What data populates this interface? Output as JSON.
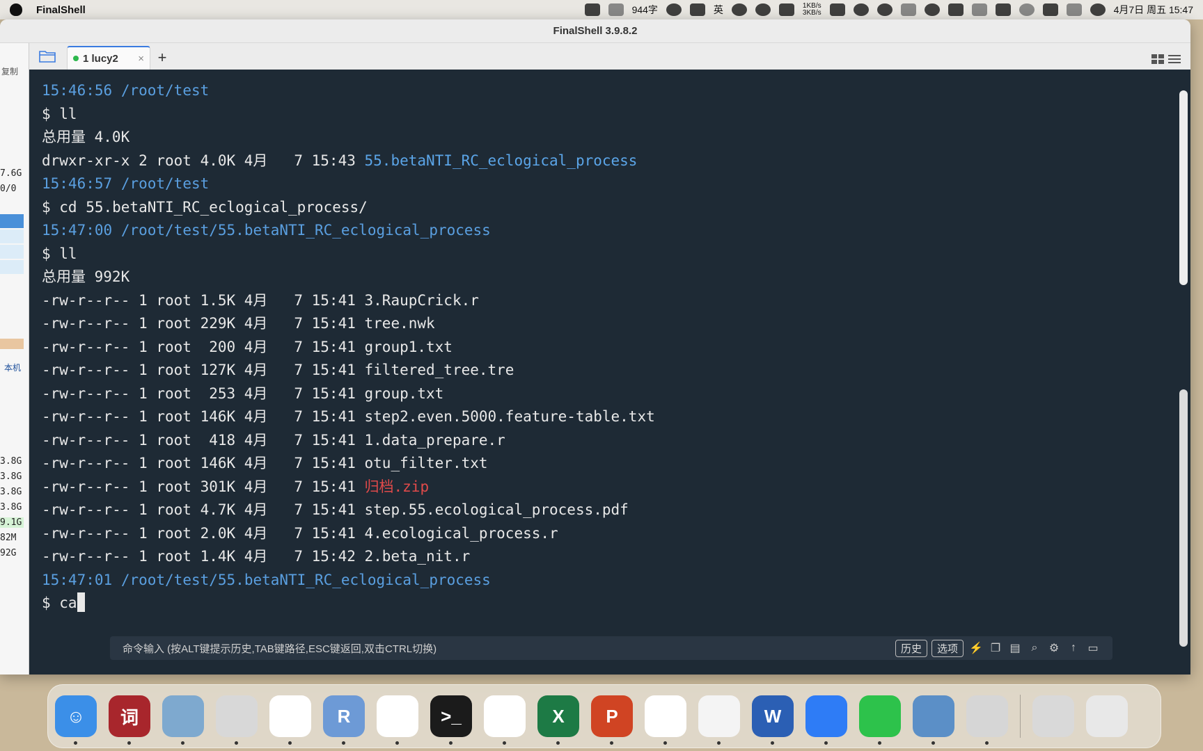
{
  "menubar": {
    "app_name": "FinalShell",
    "input_count": "944字",
    "ime_label": "英",
    "net_up": "1KB/s",
    "net_down": "3KB/s",
    "datetime": "4月7日 周五 15:47"
  },
  "window": {
    "title": "FinalShell 3.9.8.2"
  },
  "leftpanel": {
    "copy_label": "复制",
    "stats_top": [
      "7.6G",
      "0/0"
    ],
    "local_label": "本机",
    "stats_bottom": [
      "3.8G",
      "3.8G",
      "3.8G",
      "3.8G",
      "9.1G",
      "82M",
      "92G"
    ]
  },
  "tabs": [
    {
      "label": "1 lucy2",
      "close": "×"
    }
  ],
  "tab_add": "+",
  "terminal": {
    "lines": [
      {
        "type": "stamp",
        "time": "15:46:56",
        "path": "/root/test"
      },
      {
        "type": "cmd",
        "text": "$ ll"
      },
      {
        "type": "plain",
        "text": "总用量 4.0K"
      },
      {
        "type": "file",
        "meta": "drwxr-xr-x 2 root 4.0K 4月   7 15:43 ",
        "name": "55.betaNTI_RC_eclogical_process",
        "kind": "dir"
      },
      {
        "type": "stamp",
        "time": "15:46:57",
        "path": "/root/test"
      },
      {
        "type": "cmd",
        "text": "$ cd 55.betaNTI_RC_eclogical_process/"
      },
      {
        "type": "stamp",
        "time": "15:47:00",
        "path": "/root/test/55.betaNTI_RC_eclogical_process"
      },
      {
        "type": "cmd",
        "text": "$ ll"
      },
      {
        "type": "plain",
        "text": "总用量 992K"
      },
      {
        "type": "file",
        "meta": "-rw-r--r-- 1 root 1.5K 4月   7 15:41 ",
        "name": "3.RaupCrick.r",
        "kind": "file"
      },
      {
        "type": "file",
        "meta": "-rw-r--r-- 1 root 229K 4月   7 15:41 ",
        "name": "tree.nwk",
        "kind": "file"
      },
      {
        "type": "file",
        "meta": "-rw-r--r-- 1 root  200 4月   7 15:41 ",
        "name": "group1.txt",
        "kind": "file"
      },
      {
        "type": "file",
        "meta": "-rw-r--r-- 1 root 127K 4月   7 15:41 ",
        "name": "filtered_tree.tre",
        "kind": "file"
      },
      {
        "type": "file",
        "meta": "-rw-r--r-- 1 root  253 4月   7 15:41 ",
        "name": "group.txt",
        "kind": "file"
      },
      {
        "type": "file",
        "meta": "-rw-r--r-- 1 root 146K 4月   7 15:41 ",
        "name": "step2.even.5000.feature-table.txt",
        "kind": "file"
      },
      {
        "type": "file",
        "meta": "-rw-r--r-- 1 root  418 4月   7 15:41 ",
        "name": "1.data_prepare.r",
        "kind": "file"
      },
      {
        "type": "file",
        "meta": "-rw-r--r-- 1 root 146K 4月   7 15:41 ",
        "name": "otu_filter.txt",
        "kind": "file"
      },
      {
        "type": "file",
        "meta": "-rw-r--r-- 1 root 301K 4月   7 15:41 ",
        "name": "归档.zip",
        "kind": "zip"
      },
      {
        "type": "file",
        "meta": "-rw-r--r-- 1 root 4.7K 4月   7 15:41 ",
        "name": "step.55.ecological_process.pdf",
        "kind": "file"
      },
      {
        "type": "file",
        "meta": "-rw-r--r-- 1 root 2.0K 4月   7 15:41 ",
        "name": "4.ecological_process.r",
        "kind": "file"
      },
      {
        "type": "file",
        "meta": "-rw-r--r-- 1 root 1.4K 4月   7 15:42 ",
        "name": "2.beta_nit.r",
        "kind": "file"
      },
      {
        "type": "stamp",
        "time": "15:47:01",
        "path": "/root/test/55.betaNTI_RC_eclogical_process"
      },
      {
        "type": "prompt",
        "text": "$ ca"
      }
    ]
  },
  "cmdbar": {
    "placeholder": "命令输入 (按ALT键提示历史,TAB键路径,ESC键返回,双击CTRL切换)",
    "history_label": "历史",
    "options_label": "选项"
  },
  "dock": {
    "apps": [
      {
        "name": "finder",
        "color": "#3b8fe8",
        "glyph": "☺"
      },
      {
        "name": "dictionary",
        "color": "#a8262c",
        "glyph": "词"
      },
      {
        "name": "preview",
        "color": "#7ea9cf",
        "glyph": ""
      },
      {
        "name": "launchpad",
        "color": "#d8d8d8",
        "glyph": ""
      },
      {
        "name": "evernote",
        "color": "#ffffff",
        "glyph": ""
      },
      {
        "name": "r-app",
        "color": "#6d9ad6",
        "glyph": "R"
      },
      {
        "name": "chrome",
        "color": "#ffffff",
        "glyph": ""
      },
      {
        "name": "terminal",
        "color": "#1b1b1b",
        "glyph": ">_"
      },
      {
        "name": "qq",
        "color": "#ffffff",
        "glyph": ""
      },
      {
        "name": "excel",
        "color": "#1d7a45",
        "glyph": "X"
      },
      {
        "name": "powerpoint",
        "color": "#d04423",
        "glyph": "P"
      },
      {
        "name": "baidu-netdisk",
        "color": "#ffffff",
        "glyph": ""
      },
      {
        "name": "textedit",
        "color": "#f4f4f4",
        "glyph": ""
      },
      {
        "name": "word",
        "color": "#2b5fb4",
        "glyph": "W"
      },
      {
        "name": "tencent-app",
        "color": "#2e7cf6",
        "glyph": ""
      },
      {
        "name": "wechat",
        "color": "#2dc24b",
        "glyph": ""
      },
      {
        "name": "screen-sharing",
        "color": "#5b8fc7",
        "glyph": ""
      },
      {
        "name": "photo-tool",
        "color": "#d6d6d6",
        "glyph": ""
      }
    ],
    "trailing": [
      {
        "name": "documents-folder",
        "color": "#d9d9d9"
      },
      {
        "name": "trash",
        "color": "#e8e8e8"
      }
    ]
  }
}
